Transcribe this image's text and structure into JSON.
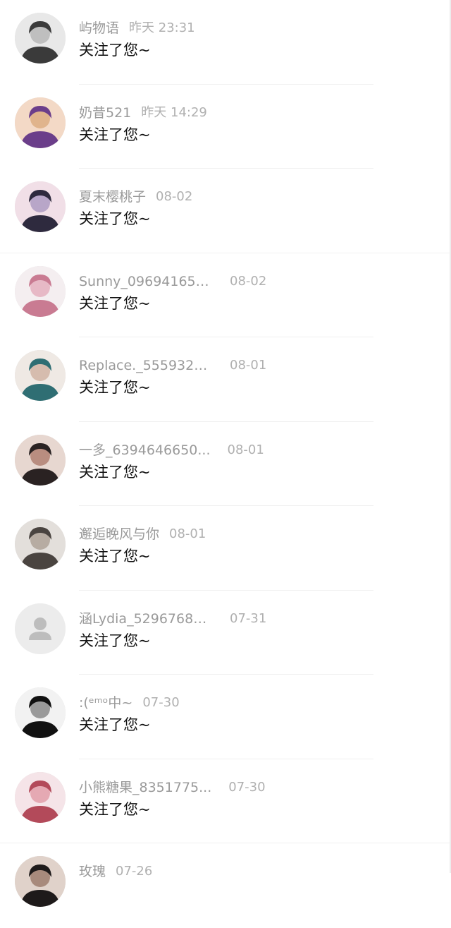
{
  "notifications": [
    {
      "name": "屿物语",
      "time": "昨天 23:31",
      "message": "关注了您~",
      "avatar": "photo-avatar",
      "tone": [
        "#3a3a3a",
        "#bfbfbf",
        "#e8e8e8"
      ]
    },
    {
      "name": "奶昔521",
      "time": "昨天 14:29",
      "message": "关注了您~",
      "avatar": "photo-avatar",
      "tone": [
        "#6b3e8a",
        "#e0b48c",
        "#f3d9c6"
      ]
    },
    {
      "name": "夏末樱桃子",
      "time": "08-02",
      "message": "关注了您~",
      "avatar": "anime-avatar",
      "tone": [
        "#2e2a3e",
        "#b8a6c8",
        "#f1dfe7"
      ]
    },
    {
      "name": "Sunny_096941653...",
      "time": "08-02",
      "message": "关注了您~",
      "avatar": "photo-avatar",
      "tone": [
        "#c97b92",
        "#e7b9c6",
        "#f4eef0"
      ]
    },
    {
      "name": "Replace._5559323...",
      "time": "08-01",
      "message": "关注了您~",
      "avatar": "photo-avatar",
      "tone": [
        "#2f6e73",
        "#d6bcae",
        "#efe9e4"
      ]
    },
    {
      "name": "一多_6394646650...",
      "time": "08-01",
      "message": "关注了您~",
      "avatar": "photo-avatar",
      "tone": [
        "#2a2222",
        "#b98d80",
        "#e7d7d0"
      ]
    },
    {
      "name": "邂逅晚风与你",
      "time": "08-01",
      "message": "关注了您~",
      "avatar": "photo-avatar",
      "tone": [
        "#4a4440",
        "#b7aca2",
        "#e3dfdb"
      ]
    },
    {
      "name": "涵Lydia_52967680...",
      "time": "07-31",
      "message": "关注了您~",
      "avatar": "default-avatar",
      "tone": [
        "#bdbdbd",
        "#bdbdbd",
        "#ececec"
      ]
    },
    {
      "name": ":(ᵉᵐᵒ中~",
      "time": "07-30",
      "message": "关注了您~",
      "avatar": "anime-avatar",
      "tone": [
        "#111111",
        "#9a9a9a",
        "#f2f2f2"
      ]
    },
    {
      "name": "小熊糖果_8351775...",
      "time": "07-30",
      "message": "关注了您~",
      "avatar": "anime-avatar",
      "tone": [
        "#b34a5a",
        "#e5a9b3",
        "#f5e4e8"
      ]
    },
    {
      "name": "玫瑰",
      "time": "07-26",
      "message": "",
      "avatar": "photo-avatar",
      "tone": [
        "#1e1a1a",
        "#a88a7c",
        "#e0d2ca"
      ]
    }
  ]
}
